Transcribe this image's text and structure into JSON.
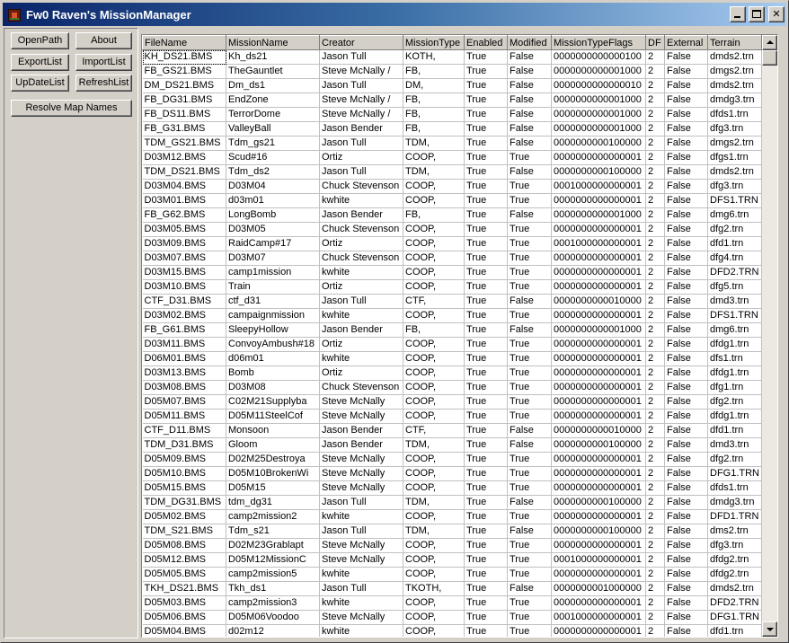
{
  "window": {
    "title": "Fw0 Raven's MissionManager"
  },
  "buttons": {
    "open_path": "OpenPath",
    "about": "About",
    "export_list": "ExportList",
    "import_list": "ImportList",
    "update_list": "UpDateList",
    "refresh_list": "RefreshList",
    "resolve_map_names": "Resolve Map Names"
  },
  "grid": {
    "columns": [
      "FileName",
      "MissionName",
      "Creator",
      "MissionType",
      "Enabled",
      "Modified",
      "MissionTypeFlags",
      "DF",
      "External",
      "Terrain"
    ],
    "rows": [
      [
        "KH_DS21.BMS",
        "Kh_ds21",
        "Jason Tull",
        "KOTH,",
        "True",
        "False",
        "0000000000000100",
        "2",
        "False",
        "dmds2.trn"
      ],
      [
        "FB_GS21.BMS",
        "TheGauntlet",
        "Steve McNally /",
        "FB,",
        "True",
        "False",
        "0000000000001000",
        "2",
        "False",
        "dmgs2.trn"
      ],
      [
        "DM_DS21.BMS",
        "Dm_ds1",
        "Jason Tull",
        "DM,",
        "True",
        "False",
        "0000000000000010",
        "2",
        "False",
        "dmds2.trn"
      ],
      [
        "FB_DG31.BMS",
        "EndZone",
        "Steve McNally /",
        "FB,",
        "True",
        "False",
        "0000000000001000",
        "2",
        "False",
        "dmdg3.trn"
      ],
      [
        "FB_DS11.BMS",
        "TerrorDome",
        "Steve McNally /",
        "FB,",
        "True",
        "False",
        "0000000000001000",
        "2",
        "False",
        "dfds1.trn"
      ],
      [
        "FB_G31.BMS",
        "ValleyBall",
        "Jason Bender",
        "FB,",
        "True",
        "False",
        "0000000000001000",
        "2",
        "False",
        "dfg3.trn"
      ],
      [
        "TDM_GS21.BMS",
        "Tdm_gs21",
        "Jason Tull",
        "TDM,",
        "True",
        "False",
        "0000000000100000",
        "2",
        "False",
        "dmgs2.trn"
      ],
      [
        "D03M12.BMS",
        "Scud#16",
        "Ortiz",
        "COOP,",
        "True",
        "True",
        "0000000000000001",
        "2",
        "False",
        "dfgs1.trn"
      ],
      [
        "TDM_DS21.BMS",
        "Tdm_ds2",
        "Jason Tull",
        "TDM,",
        "True",
        "False",
        "0000000000100000",
        "2",
        "False",
        "dmds2.trn"
      ],
      [
        "D03M04.BMS",
        "D03M04",
        "Chuck Stevenson",
        "COOP,",
        "True",
        "True",
        "0001000000000001",
        "2",
        "False",
        "dfg3.trn"
      ],
      [
        "D03M01.BMS",
        "d03m01",
        "kwhite",
        "COOP,",
        "True",
        "True",
        "0000000000000001",
        "2",
        "False",
        "DFS1.TRN"
      ],
      [
        "FB_G62.BMS",
        "LongBomb",
        "Jason Bender",
        "FB,",
        "True",
        "False",
        "0000000000001000",
        "2",
        "False",
        "dmg6.trn"
      ],
      [
        "D03M05.BMS",
        "D03M05",
        "Chuck Stevenson",
        "COOP,",
        "True",
        "True",
        "0000000000000001",
        "2",
        "False",
        "dfg2.trn"
      ],
      [
        "D03M09.BMS",
        "RaidCamp#17",
        "Ortiz",
        "COOP,",
        "True",
        "True",
        "0001000000000001",
        "2",
        "False",
        "dfd1.trn"
      ],
      [
        "D03M07.BMS",
        "D03M07",
        "Chuck Stevenson",
        "COOP,",
        "True",
        "True",
        "0000000000000001",
        "2",
        "False",
        "dfg4.trn"
      ],
      [
        "D03M15.BMS",
        "camp1mission",
        "kwhite",
        "COOP,",
        "True",
        "True",
        "0000000000000001",
        "2",
        "False",
        "DFD2.TRN"
      ],
      [
        "D03M10.BMS",
        "Train",
        "Ortiz",
        "COOP,",
        "True",
        "True",
        "0000000000000001",
        "2",
        "False",
        "dfg5.trn"
      ],
      [
        "CTF_D31.BMS",
        "ctf_d31",
        "Jason Tull",
        "CTF,",
        "True",
        "False",
        "0000000000010000",
        "2",
        "False",
        "dmd3.trn"
      ],
      [
        "D03M02.BMS",
        "campaignmission",
        "kwhite",
        "COOP,",
        "True",
        "True",
        "0000000000000001",
        "2",
        "False",
        "DFS1.TRN"
      ],
      [
        "FB_G61.BMS",
        "SleepyHollow",
        "Jason Bender",
        "FB,",
        "True",
        "False",
        "0000000000001000",
        "2",
        "False",
        "dmg6.trn"
      ],
      [
        "D03M11.BMS",
        "ConvoyAmbush#18",
        "Ortiz",
        "COOP,",
        "True",
        "True",
        "0000000000000001",
        "2",
        "False",
        "dfdg1.trn"
      ],
      [
        "D06M01.BMS",
        "d06m01",
        "kwhite",
        "COOP,",
        "True",
        "True",
        "0000000000000001",
        "2",
        "False",
        "dfs1.trn"
      ],
      [
        "D03M13.BMS",
        "Bomb",
        "Ortiz",
        "COOP,",
        "True",
        "True",
        "0000000000000001",
        "2",
        "False",
        "dfdg1.trn"
      ],
      [
        "D03M08.BMS",
        "D03M08",
        "Chuck Stevenson",
        "COOP,",
        "True",
        "True",
        "0000000000000001",
        "2",
        "False",
        "dfg1.trn"
      ],
      [
        "D05M07.BMS",
        "C02M21Supplyba",
        "Steve McNally",
        "COOP,",
        "True",
        "True",
        "0000000000000001",
        "2",
        "False",
        "dfg2.trn"
      ],
      [
        "D05M11.BMS",
        "D05M11SteelCof",
        "Steve McNally",
        "COOP,",
        "True",
        "True",
        "0000000000000001",
        "2",
        "False",
        "dfdg1.trn"
      ],
      [
        "CTF_D11.BMS",
        "Monsoon",
        "Jason Bender",
        "CTF,",
        "True",
        "False",
        "0000000000010000",
        "2",
        "False",
        "dfd1.trn"
      ],
      [
        "TDM_D31.BMS",
        "Gloom",
        "Jason Bender",
        "TDM,",
        "True",
        "False",
        "0000000000100000",
        "2",
        "False",
        "dmd3.trn"
      ],
      [
        "D05M09.BMS",
        "D02M25Destroya",
        "Steve McNally",
        "COOP,",
        "True",
        "True",
        "0000000000000001",
        "2",
        "False",
        "dfg2.trn"
      ],
      [
        "D05M10.BMS",
        "D05M10BrokenWi",
        "Steve McNally",
        "COOP,",
        "True",
        "True",
        "0000000000000001",
        "2",
        "False",
        "DFG1.TRN"
      ],
      [
        "D05M15.BMS",
        "D05M15",
        "Steve McNally",
        "COOP,",
        "True",
        "True",
        "0000000000000001",
        "2",
        "False",
        "dfds1.trn"
      ],
      [
        "TDM_DG31.BMS",
        "tdm_dg31",
        "Jason Tull",
        "TDM,",
        "True",
        "False",
        "0000000000100000",
        "2",
        "False",
        "dmdg3.trn"
      ],
      [
        "D05M02.BMS",
        "camp2mission2",
        "kwhite",
        "COOP,",
        "True",
        "True",
        "0000000000000001",
        "2",
        "False",
        "DFD1.TRN"
      ],
      [
        "TDM_S21.BMS",
        "Tdm_s21",
        "Jason Tull",
        "TDM,",
        "True",
        "False",
        "0000000000100000",
        "2",
        "False",
        "dms2.trn"
      ],
      [
        "D05M08.BMS",
        "D02M23Grablapt",
        "Steve McNally",
        "COOP,",
        "True",
        "True",
        "0000000000000001",
        "2",
        "False",
        "dfg3.trn"
      ],
      [
        "D05M12.BMS",
        "D05M12MissionC",
        "Steve McNally",
        "COOP,",
        "True",
        "True",
        "0001000000000001",
        "2",
        "False",
        "dfdg2.trn"
      ],
      [
        "D05M05.BMS",
        "camp2mission5",
        "kwhite",
        "COOP,",
        "True",
        "True",
        "0000000000000001",
        "2",
        "False",
        "dfdg2.trn"
      ],
      [
        "TKH_DS21.BMS",
        "Tkh_ds1",
        "Jason Tull",
        "TKOTH,",
        "True",
        "False",
        "0000000001000000",
        "2",
        "False",
        "dmds2.trn"
      ],
      [
        "D05M03.BMS",
        "camp2mission3",
        "kwhite",
        "COOP,",
        "True",
        "True",
        "0000000000000001",
        "2",
        "False",
        "DFD2.TRN"
      ],
      [
        "D05M06.BMS",
        "D05M06Voodoo",
        "Steve McNally",
        "COOP,",
        "True",
        "True",
        "0001000000000001",
        "2",
        "False",
        "DFG1.TRN"
      ],
      [
        "D05M04.BMS",
        "d02m12",
        "kwhite",
        "COOP,",
        "True",
        "True",
        "0000000000000001",
        "2",
        "False",
        "dfd1.trn"
      ]
    ]
  }
}
